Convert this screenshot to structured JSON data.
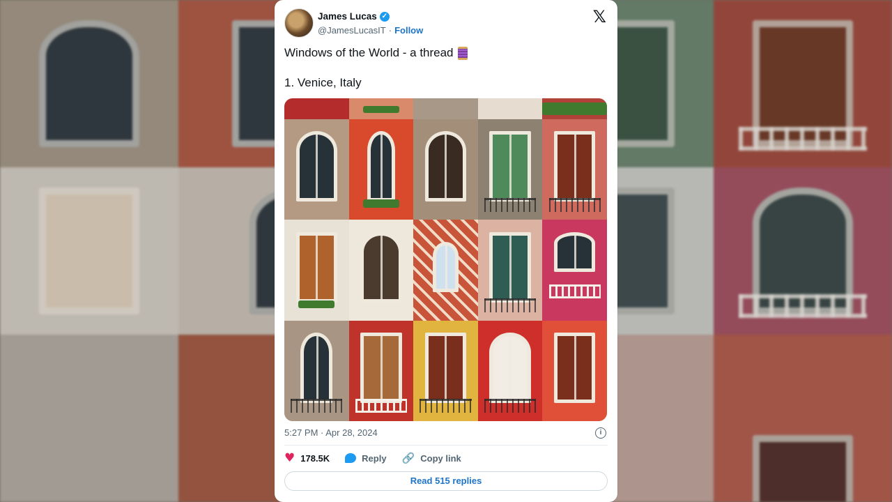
{
  "tweet": {
    "author_name": "James Lucas",
    "handle": "@JamesLucasIT",
    "separator": "·",
    "follow_label": "Follow",
    "x_logo": "𝕏",
    "text_line1": "Windows of the World - a thread",
    "thread_icon": "thread-spool",
    "text_line2": "1. Venice, Italy",
    "timestamp": "5:27 PM · Apr 28, 2024",
    "info_glyph": "i",
    "likes": "178.5K",
    "reply_label": "Reply",
    "copy_link_label": "Copy link",
    "read_replies_label": "Read 515 replies",
    "verified_glyph": "✓",
    "heart_glyph": "♥",
    "link_glyph": "🔗"
  },
  "colors": {
    "accent": "#1d9bf0",
    "link": "#1d74c8",
    "heart": "#e0245e",
    "text": "#0f1419",
    "muted": "#536471"
  }
}
